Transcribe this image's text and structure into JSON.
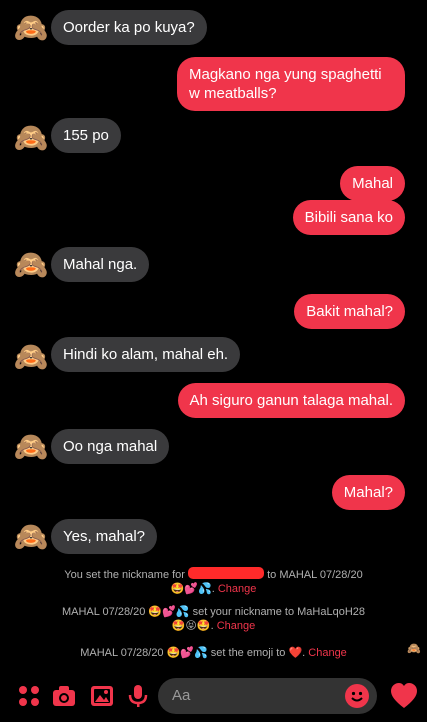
{
  "messages": [
    {
      "side": "in",
      "text": "Oorder ka po kuya?"
    },
    {
      "side": "out",
      "text": "Magkano nga yung spaghetti w meatballs?"
    },
    {
      "side": "in",
      "text": "155 po"
    },
    {
      "side": "out",
      "text": "Mahal"
    },
    {
      "side": "out",
      "text": "Bibili sana ko"
    },
    {
      "side": "in",
      "text": "Mahal nga."
    },
    {
      "side": "out",
      "text": "Bakit mahal?"
    },
    {
      "side": "in",
      "text": "Hindi ko alam, mahal eh."
    },
    {
      "side": "out",
      "text": "Ah siguro ganun talaga mahal."
    },
    {
      "side": "in",
      "text": "Oo nga mahal"
    },
    {
      "side": "out",
      "text": "Mahal?"
    },
    {
      "side": "in",
      "text": "Yes, mahal?"
    }
  ],
  "system": {
    "nickname1_prefix": "You set the nickname for",
    "nickname1_suffix": "to MAHAL 07/28/20",
    "nickname1_emojis": "🤩💕💦.",
    "nickname2_prefix": "MAHAL 07/28/20",
    "nickname2_emojis_a": "🤩💕💦",
    "nickname2_text": "set your nickname to MaHaLqoH28",
    "nickname2_emojis_b": "🤩😝🤩.",
    "emoji_prefix": "MAHAL 07/28/20",
    "emoji_emojis": "🤩💕💦",
    "emoji_text": "set the emoji to",
    "emoji_heart": "❤️.",
    "change": "Change"
  },
  "avatar_emoji": "🙈",
  "composer": {
    "placeholder": "Aa",
    "like_emoji": "❤️"
  },
  "colors": {
    "outgoing_bubble": "#f0354b",
    "incoming_bubble": "#3a3a3c",
    "accent": "#f0354b"
  }
}
